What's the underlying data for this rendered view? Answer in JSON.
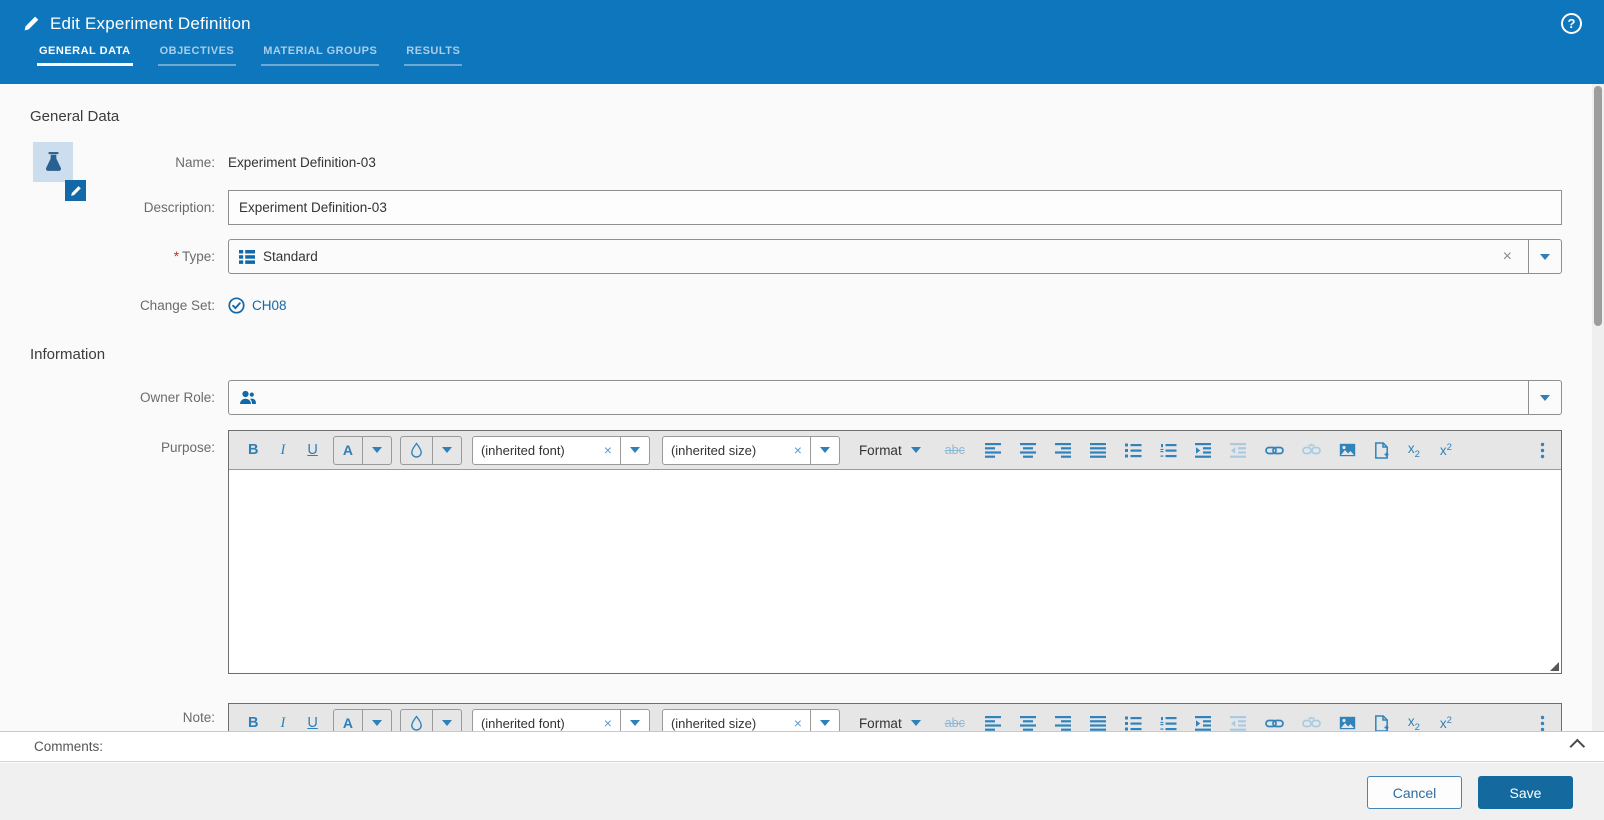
{
  "header": {
    "title": "Edit Experiment Definition",
    "help_glyph": "?",
    "active_tab": "GENERAL DATA",
    "tabs": [
      {
        "label": "GENERAL DATA"
      },
      {
        "label": "OBJECTIVES"
      },
      {
        "label": "MATERIAL GROUPS"
      },
      {
        "label": "RESULTS"
      }
    ]
  },
  "general": {
    "section_title": "General Data",
    "entity_icon": "flask-icon",
    "name_label": "Name:",
    "name_value": "Experiment Definition-03",
    "description_label": "Description:",
    "description_value": "Experiment Definition-03",
    "required_marker": "*",
    "type_label": "Type:",
    "type_value": "Standard",
    "clear_glyph": "×",
    "changeset_label": "Change Set:",
    "changeset_value": "CH08"
  },
  "information": {
    "section_title": "Information",
    "owner_role_label": "Owner Role:",
    "owner_role_value": "",
    "purpose_label": "Purpose:",
    "purpose_value": "",
    "note_label": "Note:"
  },
  "editor": {
    "bold": "B",
    "italic": "I",
    "underline": "U",
    "font_color": "A",
    "font_name": "(inherited font)",
    "font_size": "(inherited size)",
    "clear_glyph": "×",
    "format_label": "Format",
    "strikethrough": "abc",
    "subscript_base": "x",
    "subscript_char": "2",
    "superscript_base": "x",
    "superscript_char": "2"
  },
  "comments": {
    "label": "Comments:"
  },
  "footer": {
    "cancel_label": "Cancel",
    "save_label": "Save"
  },
  "colors": {
    "header_blue": "#0d76bd",
    "accent_blue": "#3183bb",
    "link_blue": "#1268a8",
    "save_blue": "#14699f",
    "toolbar_gray": "#e6e6e6",
    "content_bg": "#fafafa"
  }
}
